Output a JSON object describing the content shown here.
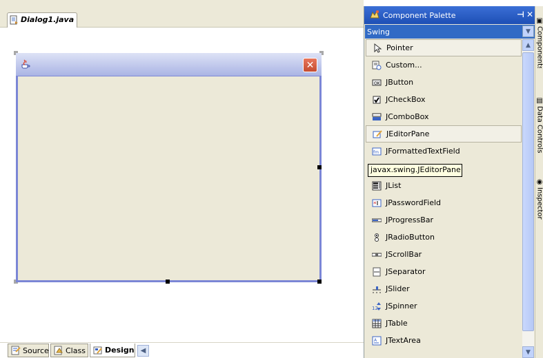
{
  "editor": {
    "file_tab": "Dialog1.java"
  },
  "bottom_tabs": [
    {
      "label": "Source",
      "icon": "source-icon"
    },
    {
      "label": "Class",
      "icon": "class-icon"
    },
    {
      "label": "Design",
      "icon": "design-icon",
      "active": true
    }
  ],
  "palette": {
    "title": "Component Palette",
    "category": "Swing",
    "items": [
      {
        "label": "Pointer",
        "icon": "pointer-icon"
      },
      {
        "label": "Custom...",
        "icon": "custom-icon"
      },
      {
        "label": "JButton",
        "icon": "jbutton-icon"
      },
      {
        "label": "JCheckBox",
        "icon": "jcheckbox-icon"
      },
      {
        "label": "JComboBox",
        "icon": "jcombobox-icon"
      },
      {
        "label": "JEditorPane",
        "icon": "jeditorpane-icon"
      },
      {
        "label": "JFormattedTextField",
        "icon": "jformattedtextfield-icon"
      },
      {
        "label": "JList",
        "icon": "jlist-icon"
      },
      {
        "label": "JPasswordField",
        "icon": "jpasswordfield-icon"
      },
      {
        "label": "JProgressBar",
        "icon": "jprogressbar-icon"
      },
      {
        "label": "JRadioButton",
        "icon": "jradiobutton-icon"
      },
      {
        "label": "JScrollBar",
        "icon": "jscrollbar-icon"
      },
      {
        "label": "JSeparator",
        "icon": "jseparator-icon"
      },
      {
        "label": "JSlider",
        "icon": "jslider-icon"
      },
      {
        "label": "JSpinner",
        "icon": "jspinner-icon"
      },
      {
        "label": "JTable",
        "icon": "jtable-icon"
      },
      {
        "label": "JTextArea",
        "icon": "jtextarea-icon"
      }
    ],
    "tooltip": "javax.swing.JEditorPane"
  },
  "side_tabs": [
    {
      "label": "Components"
    },
    {
      "label": "Data Controls"
    },
    {
      "label": "Inspector"
    }
  ],
  "colors": {
    "palette_header": "#2a5bc6",
    "selection": "#316ac5",
    "dialog_border": "#7b86d6"
  }
}
